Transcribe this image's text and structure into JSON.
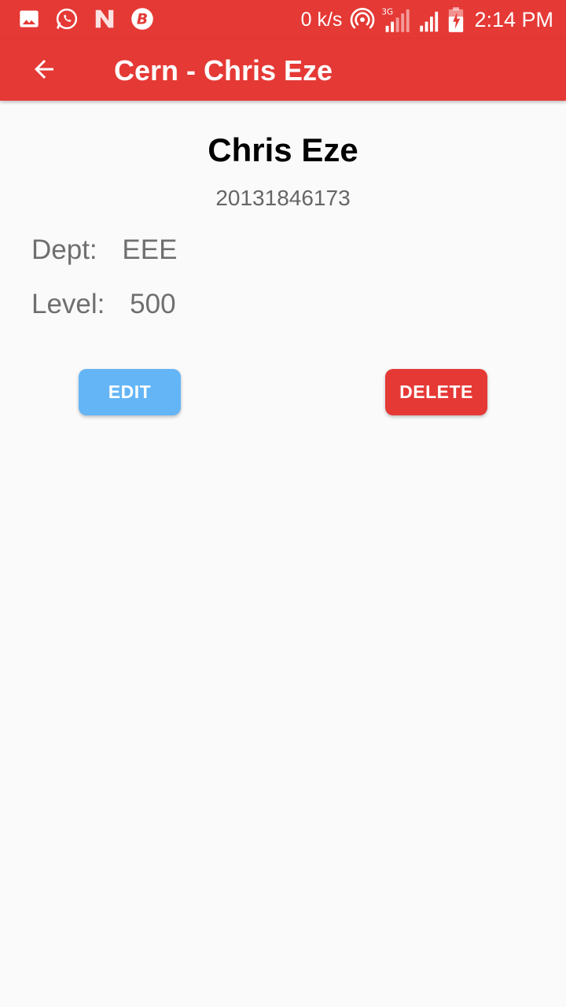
{
  "status_bar": {
    "speed": "0 k/s",
    "time": "2:14 PM",
    "icons": [
      "gallery-icon",
      "whatsapp-icon",
      "n-app-icon",
      "b-app-icon",
      "hotspot-icon",
      "signal-3g-icon",
      "signal-icon",
      "battery-charging-icon"
    ]
  },
  "app_bar": {
    "title": "Cern - Chris Eze",
    "back_icon": "arrow-back-icon"
  },
  "student": {
    "name": "Chris Eze",
    "reg_number": "20131846173",
    "dept_label": "Dept:",
    "dept_value": "EEE",
    "level_label": "Level:",
    "level_value": "500"
  },
  "actions": {
    "edit_label": "EDIT",
    "delete_label": "DELETE"
  },
  "colors": {
    "primary": "#e53935",
    "edit_button": "#64b5f6",
    "background": "#fafafa"
  }
}
